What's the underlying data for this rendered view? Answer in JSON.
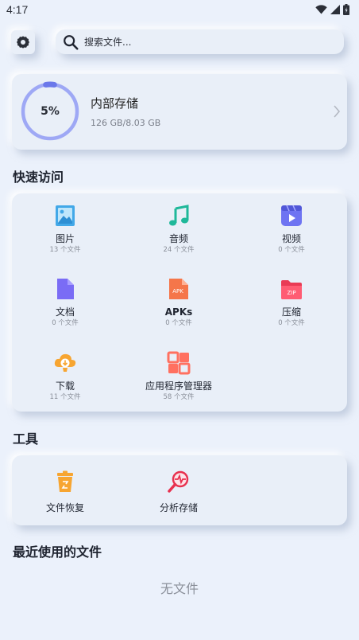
{
  "status_bar": {
    "time": "4:17"
  },
  "search": {
    "placeholder": "搜索文件..."
  },
  "storage": {
    "percent": "5%",
    "used_fraction": 0.05,
    "title": "内部存储",
    "size": "126 GB/8.03 GB"
  },
  "sections": {
    "quick_access": "快速访问",
    "tools": "工具",
    "recent": "最近使用的文件"
  },
  "quick_access": [
    {
      "name": "图片",
      "count": "13 个文件",
      "icon": "image-icon"
    },
    {
      "name": "音频",
      "count": "24 个文件",
      "icon": "music-note-icon"
    },
    {
      "name": "视频",
      "count": "0 个文件",
      "icon": "video-icon"
    },
    {
      "name": "文档",
      "count": "0 个文件",
      "icon": "document-icon"
    },
    {
      "name": "APKs",
      "count": "0 个文件",
      "icon": "apk-file-icon"
    },
    {
      "name": "压缩",
      "count": "0 个文件",
      "icon": "zip-folder-icon"
    },
    {
      "name": "下载",
      "count": "11 个文件",
      "icon": "cloud-download-icon"
    },
    {
      "name": "应用程序管理器",
      "count": "58 个文件",
      "icon": "app-grid-icon"
    }
  ],
  "icon_labels": {
    "apk": "APK",
    "zip": "ZIP"
  },
  "tools": [
    {
      "name": "文件恢复",
      "icon": "recycle-bin-icon"
    },
    {
      "name": "分析存储",
      "icon": "storage-analysis-icon"
    }
  ],
  "recent": {
    "empty_text": "无文件"
  },
  "colors": {
    "background": "#ebf1fb",
    "accent": "#9ea8f5",
    "ring_track": "#9ea8f5",
    "ring_progress": "#6b78ea"
  }
}
